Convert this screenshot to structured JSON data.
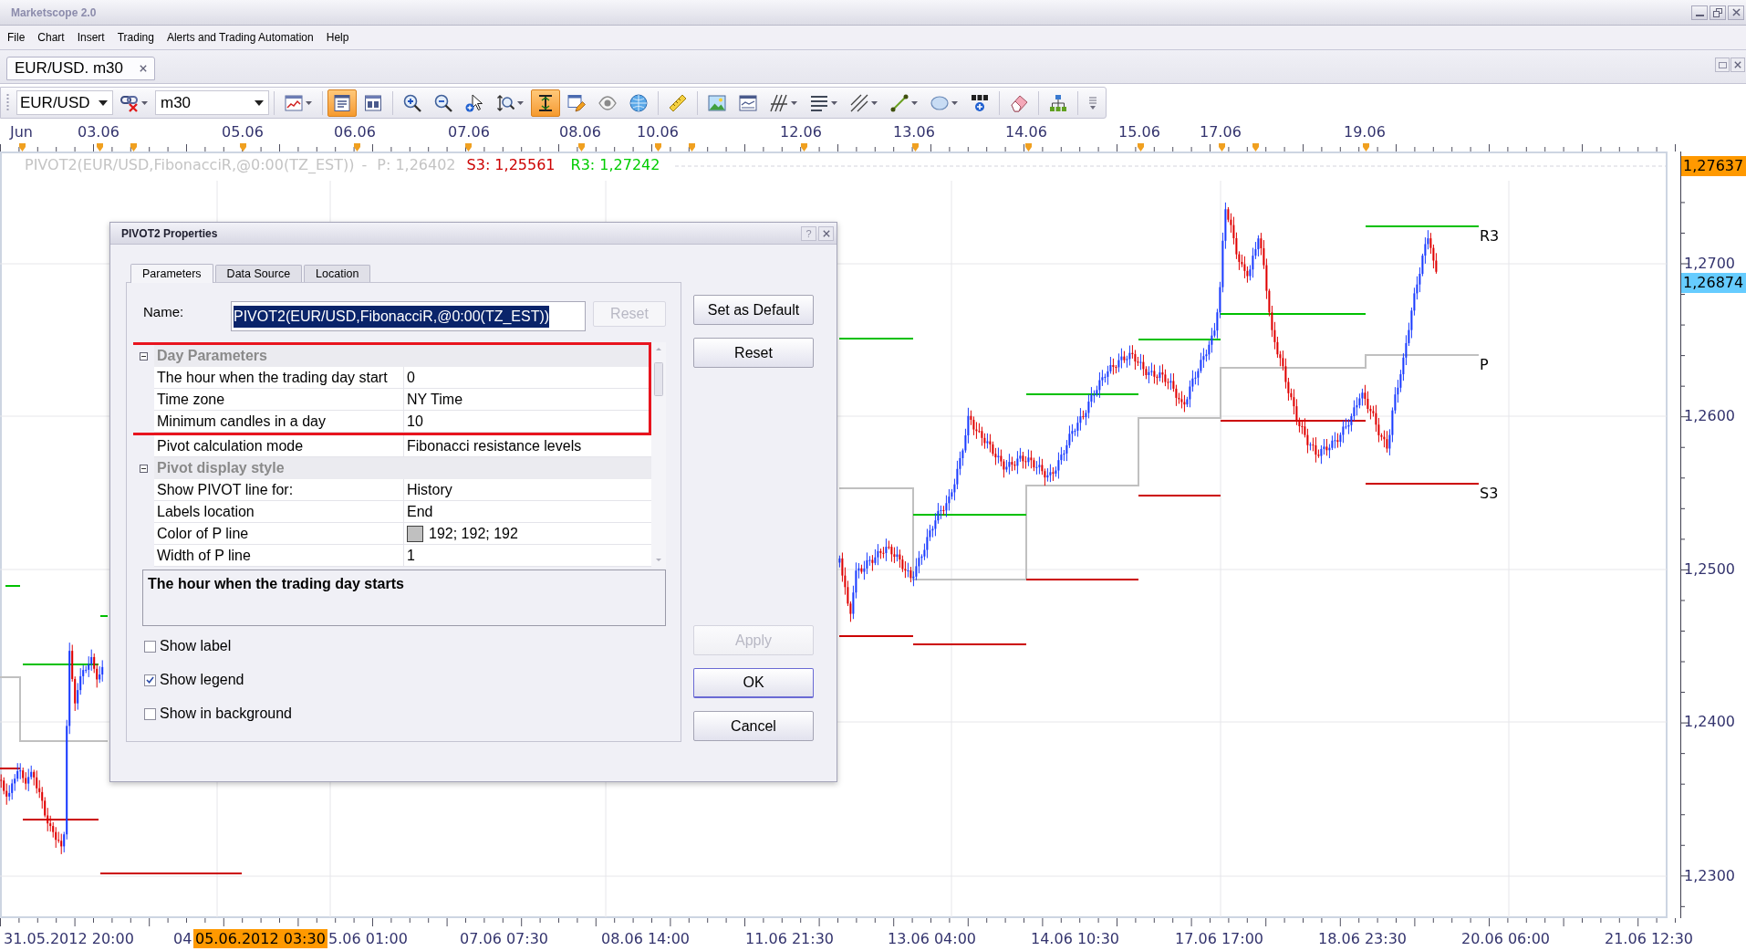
{
  "window": {
    "title": "Marketscope 2.0"
  },
  "menu": [
    "File",
    "Chart",
    "Insert",
    "Trading",
    "Alerts and Trading Automation",
    "Help"
  ],
  "document_tabs": [
    {
      "label": "EUR/USD. m30",
      "selected": true
    }
  ],
  "toolbar": {
    "symbol": "EUR/USD",
    "timeframe": "m30",
    "buttons": [
      {
        "pressed": false
      },
      {
        "pressed": false
      },
      {
        "pressed": true
      },
      {
        "pressed": false
      },
      {
        "pressed": false
      },
      {
        "pressed": false
      },
      {
        "pressed": false
      },
      {
        "pressed": false
      },
      {
        "pressed": true
      },
      {
        "pressed": false
      },
      {
        "pressed": false
      },
      {
        "pressed": false
      },
      {
        "pressed": false
      },
      {
        "pressed": false
      },
      {
        "pressed": false
      },
      {
        "pressed": false
      },
      {
        "pressed": false
      },
      {
        "pressed": false
      },
      {
        "pressed": false
      },
      {
        "pressed": false
      },
      {
        "pressed": false
      },
      {
        "pressed": false
      },
      {
        "pressed": false
      },
      {
        "pressed": false
      }
    ]
  },
  "chart": {
    "time_header": [
      "Jun",
      "03.06",
      "05.06",
      "06.06",
      "07.06",
      "08.06",
      "10.06",
      "12.06",
      "13.06",
      "14.06",
      "15.06",
      "17.06",
      "19.06"
    ],
    "legend": [
      {
        "text": "PIVOT2(EUR/USD,FibonacciR,@0:00(TZ_EST))",
        "color": "#c4c4c4"
      },
      {
        "text": "-",
        "color": "#c4c4c4"
      },
      {
        "text": "P: 1,26402",
        "color": "#c4c4c4"
      },
      {
        "text": "S3: 1,25561",
        "color": "#cc0000"
      },
      {
        "text": "R3: 1,27242",
        "color": "#00cc00"
      }
    ],
    "level_labels": [
      "R3",
      "P",
      "S3"
    ],
    "price_axis": [
      "1,2700",
      "1,2600",
      "1,2500",
      "1,2400",
      "1,2300"
    ],
    "price_markers": [
      {
        "text": "1,27637",
        "color": "#ff9900"
      },
      {
        "text": "1,26874",
        "color": "#66ccff"
      }
    ],
    "time_axis": [
      "31.05.2012 20:00",
      "04",
      "5.06 01:00",
      "07.06 07:30",
      "08.06 14:00",
      "11.06 21:30",
      "13.06 04:00",
      "14.06 10:30",
      "17.06 17:00",
      "18.06 23:30",
      "20.06 06:00",
      "21.06 12:30"
    ],
    "time_cursor": "05.06.2012 03:30"
  },
  "dialog": {
    "title": "PIVOT2 Properties",
    "help_button": "?",
    "tabs": [
      {
        "label": "Parameters",
        "selected": true
      },
      {
        "label": "Data Source",
        "selected": false
      },
      {
        "label": "Location",
        "selected": false
      }
    ],
    "name_field": {
      "label": "Name:",
      "value": "PIVOT2(EUR/USD,FibonacciR,@0:00(TZ_EST))",
      "text_selected": true
    },
    "name_reset_button": {
      "label": "Reset",
      "disabled": true
    },
    "property_grid": [
      {
        "label": "Day Parameters",
        "expanded": true,
        "highlighted": true,
        "children": [
          {
            "kind": "text",
            "name": "The hour when the trading day start",
            "value": "0",
            "highlighted": true
          },
          {
            "kind": "text",
            "name": "Time zone",
            "value": "NY Time",
            "highlighted": true
          },
          {
            "kind": "text",
            "name": "Minimum candles in a day",
            "value": "10",
            "highlighted": true
          },
          {
            "kind": "text",
            "name": "Pivot calculation mode",
            "value": "Fibonacci resistance levels",
            "highlighted": false
          }
        ]
      },
      {
        "label": "Pivot display style",
        "expanded": true,
        "highlighted": false,
        "children": [
          {
            "kind": "text",
            "name": "Show PIVOT line for:",
            "value": "History",
            "highlighted": false
          },
          {
            "kind": "text",
            "name": "Labels location",
            "value": "End",
            "highlighted": false
          },
          {
            "kind": "color",
            "name": "Color of P line",
            "value": "192; 192; 192",
            "color": "#c0c0c0",
            "highlighted": false
          },
          {
            "kind": "text",
            "name": "Width of P line",
            "value": "1",
            "highlighted": false
          }
        ]
      }
    ],
    "description": "The hour when the trading day starts",
    "checkboxes": [
      {
        "label": "Show label",
        "checked": false
      },
      {
        "label": "Show legend",
        "checked": true
      },
      {
        "label": "Show in background",
        "checked": false
      }
    ],
    "side_buttons": [
      {
        "label": "Set as Default",
        "disabled": false,
        "default": false
      },
      {
        "label": "Reset",
        "disabled": false,
        "default": false
      }
    ],
    "action_buttons": [
      {
        "label": "Apply",
        "disabled": true,
        "default": false
      },
      {
        "label": "OK",
        "disabled": false,
        "default": true
      },
      {
        "label": "Cancel",
        "disabled": false,
        "default": false
      }
    ]
  }
}
